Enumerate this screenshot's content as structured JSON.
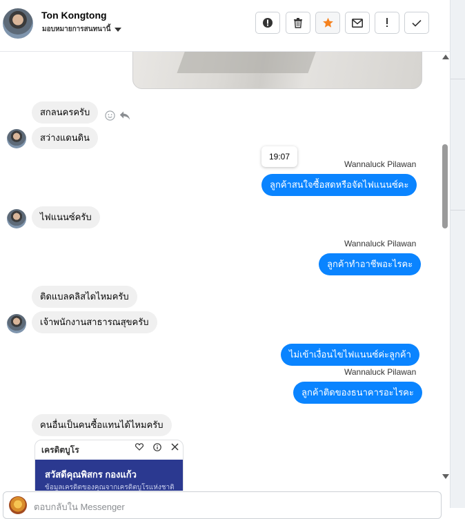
{
  "header": {
    "contact_name": "Ton Kongtong",
    "assignee_label": "มอบหมายการสนทนานี้",
    "actions": [
      {
        "icon": "alert-circle-icon"
      },
      {
        "icon": "trash-icon"
      },
      {
        "icon": "star-icon"
      },
      {
        "icon": "mail-icon"
      },
      {
        "icon": "exclamation-icon"
      },
      {
        "icon": "check-icon"
      }
    ]
  },
  "colors": {
    "outgoing_bubble": "#0a84ff",
    "incoming_bubble": "#f0f0f0",
    "star": "#f5821f",
    "card_banner": "#2b3990"
  },
  "messages": {
    "m1": "สกลนครครับ",
    "m2": "สว่างแดนดิน",
    "time_tooltip": "19:07",
    "sender1": "Wannaluck Pilawan",
    "m3": "ลูกค้าสนใจซื้อสดหรือจัดไฟแนนซ์คะ",
    "m4": "ไฟแนนซ์ครับ",
    "sender2": "Wannaluck Pilawan",
    "m5": "ลูกค้าทำอาชีพอะไรคะ",
    "m6": "ติดแบลคลิสไดไหมครับ",
    "m7": "เจ้าพนักงานสาธารณสุขครับ",
    "m8": "ไม่เข้าเงื่อนไขไฟแนนซ์ค่ะลูกค้า",
    "sender3": "Wannaluck Pilawan",
    "m9": "ลูกค้าติดของธนาคารอะไรคะ",
    "m10": "คนอื่นเป็นคนซื้อแทนได้ไหมครับ"
  },
  "card": {
    "title": "เครดิตบูโร",
    "banner_title": "สวัสดีคุณพิสกร กองแก้ว",
    "banner_sub": "ข้อมูลเครดิตของคุณจากเครดิตบูโรแห่งชาติ"
  },
  "composer": {
    "placeholder": "ตอบกลับใน Messenger"
  }
}
